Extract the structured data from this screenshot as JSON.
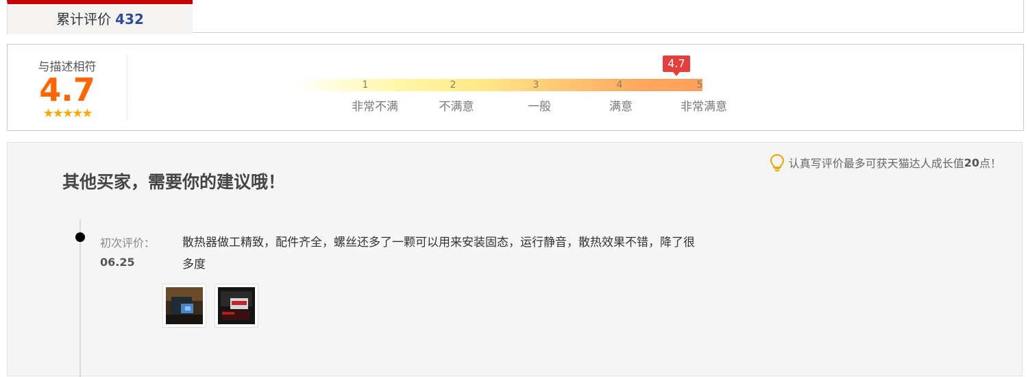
{
  "tab": {
    "label": "累计评价",
    "count": "432"
  },
  "rating": {
    "label": "与描述相符",
    "score": "4.7",
    "stars": "★★★★★",
    "marker_value": "4.7",
    "scale_ticks": [
      "1",
      "2",
      "3",
      "4",
      "5"
    ],
    "scale_words": [
      "非常不满",
      "不满意",
      "一般",
      "满意",
      "非常满意"
    ]
  },
  "review_section": {
    "heading": "其他买家，需要你的建议哦！",
    "tip_prefix": "认真写评价最多可获天猫达人成长值",
    "tip_points": "20",
    "tip_suffix": "点！",
    "review": {
      "label": "初次评价：",
      "date": "06.25",
      "text": "散热器做工精致，配件齐全，螺丝还多了一颗可以用来安装固态，运行静音，散热效果不错，降了很多度",
      "images": [
        "review-photo-1",
        "review-photo-2"
      ]
    }
  },
  "colors": {
    "accent": "#c40000",
    "score": "#ff6600",
    "marker": "#e63d3d",
    "count": "#2b4e9b"
  }
}
